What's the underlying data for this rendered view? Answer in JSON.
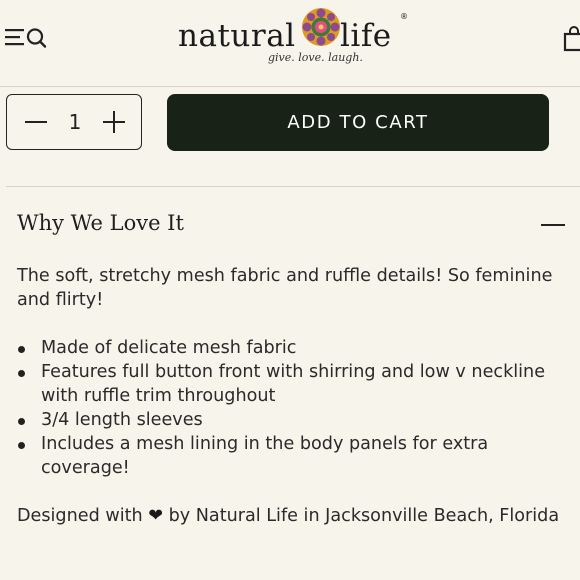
{
  "header": {
    "logo": {
      "word_left": "natural",
      "word_right": "life",
      "registered": "®",
      "tagline": "give. love. laugh."
    }
  },
  "purchase": {
    "quantity": "1",
    "add_to_cart_label": "ADD TO CART"
  },
  "details": {
    "title": "Why We Love It",
    "intro": "The soft, stretchy mesh fabric and ruffle details! So feminine and flirty!",
    "features": [
      "Made of delicate mesh fabric",
      "Features full button front with shirring and low v neckline with ruffle trim throughout",
      "3/4 length sleeves",
      "Includes a mesh lining in the body panels for extra coverage!"
    ],
    "credit_prefix": "Designed with",
    "credit_heart": "❤",
    "credit_suffix": "by Natural Life in Jacksonville Beach, Florida"
  },
  "colors": {
    "background": "#f7f4ec",
    "button": "#182216",
    "text": "#2a2a2a"
  }
}
